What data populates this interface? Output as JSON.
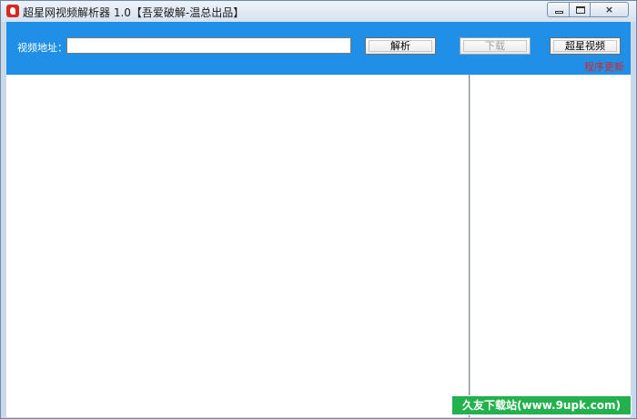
{
  "window": {
    "title": "超星网视频解析器 1.0【吾爱破解-温总出品】",
    "controls": {
      "minimize": "minimize-icon",
      "maximize": "maximize-icon",
      "close": "×"
    }
  },
  "toolbar": {
    "url_label": "视频地址：",
    "url_value": "",
    "url_placeholder": "",
    "parse_label": "解析",
    "download_label": "下载",
    "chaoxing_label": "超星视频",
    "update_link": "程序更新",
    "bg_color": "#1f8fe8",
    "update_color": "#d6262a"
  },
  "watermark": {
    "text": "久友下载站(www.9upk.com)"
  }
}
